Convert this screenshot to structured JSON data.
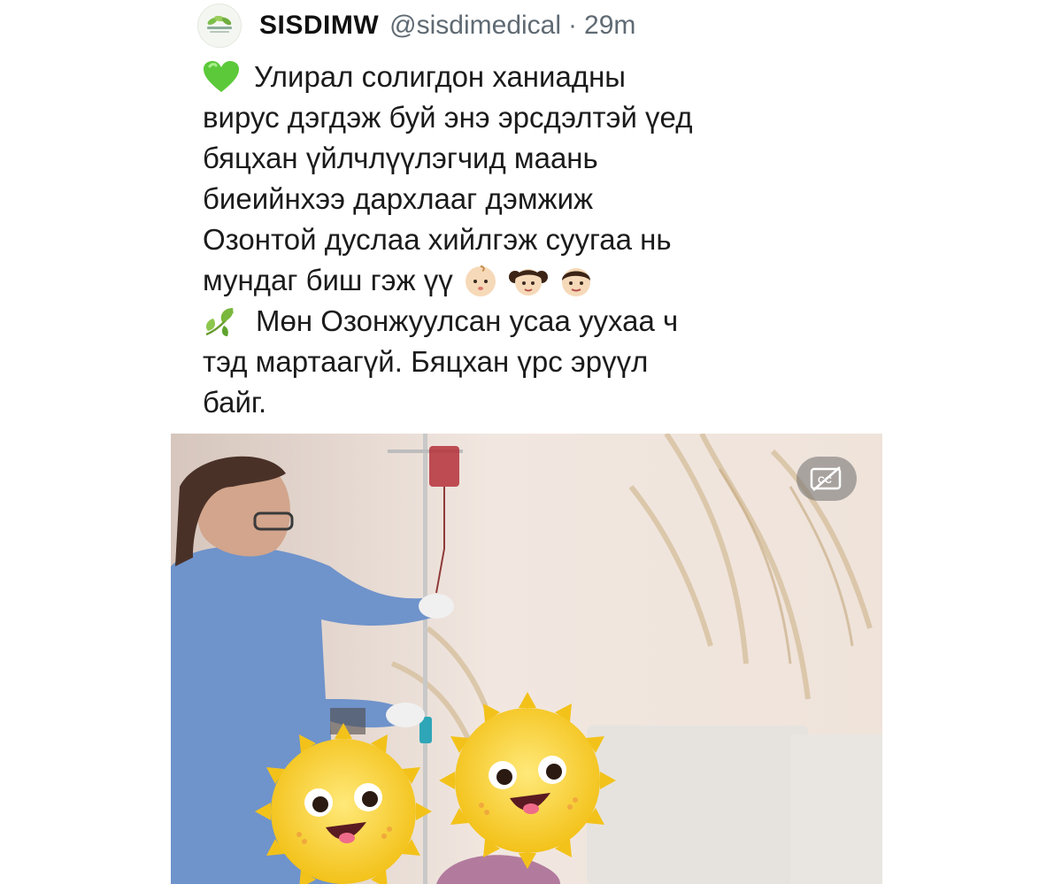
{
  "post": {
    "author": {
      "display_name": "SISDIMW",
      "handle": "@sisdimedical",
      "separator": "·",
      "time": "29m"
    },
    "lines": [
      "Улирал солигдон ханиадны",
      "вирус дэгдэж буй энэ эрсдэлтэй үед",
      "бяцхан үйлчлүүлэгчид маань",
      "биеийнхээ дархлааг дэмжиж",
      "Озонтой дуслаа хийлгэж суугаа нь",
      "мундаг биш гэж үү",
      "Мөн Озонжуулсан усаа уухаа ч",
      "тэд мартаагүй. Бяцхан үрс эрүүл",
      "байг."
    ],
    "icons": {
      "line1_leading": "green-heart-icon",
      "line6_trailing": [
        "baby-icon",
        "girl-icon",
        "boy-icon"
      ],
      "line7_leading": "leaves-icon"
    }
  },
  "media": {
    "type": "video",
    "cc_button": "closed-captions-icon",
    "overlay_stickers": [
      "sun-face-sticker",
      "sun-face-sticker"
    ]
  }
}
